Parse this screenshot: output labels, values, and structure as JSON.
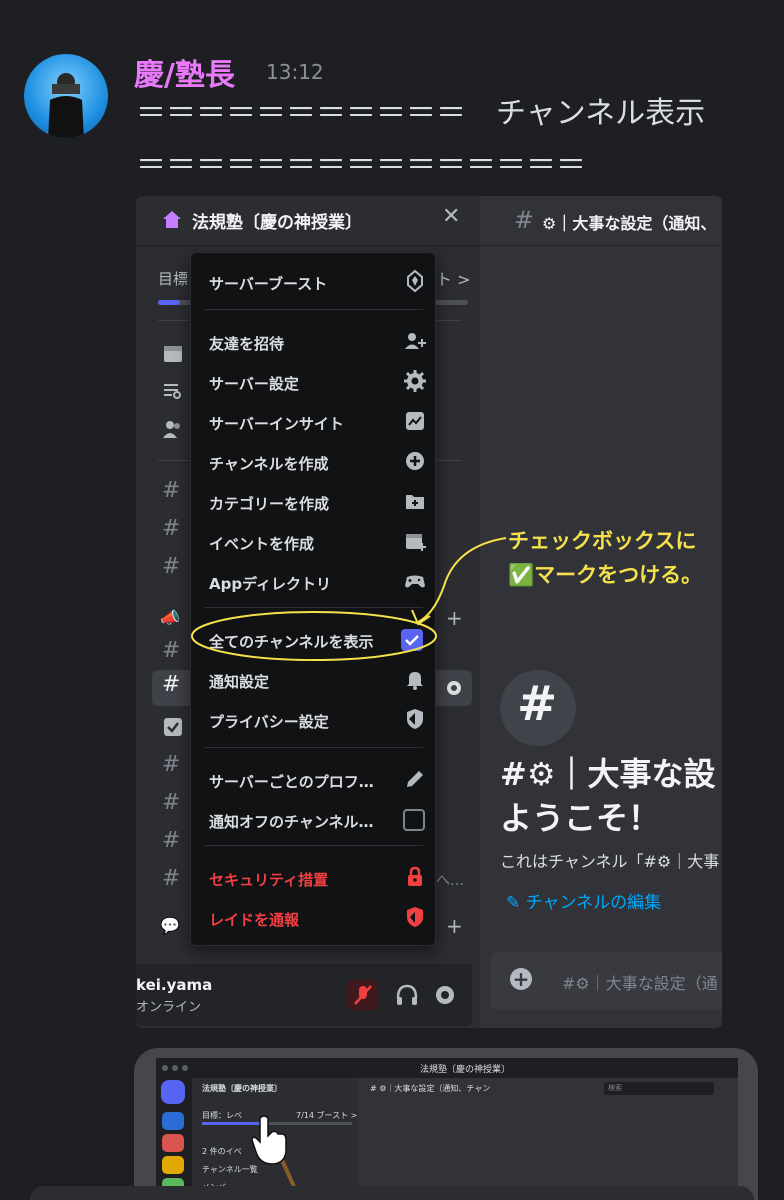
{
  "message": {
    "author": "慶/塾長",
    "timestamp": "13:12",
    "line1": "＝＝＝＝＝＝＝＝＝＝＝　チャンネル表示",
    "line2": "＝＝＝＝＝＝＝＝＝＝＝＝＝＝＝"
  },
  "screenshot": {
    "server_name": "法規塾〔慶の神授業〕",
    "channel_title": "⚙｜大事な設定（通知、",
    "goal_label": "目標",
    "goal_suffix": "ト >",
    "goal_progress": 0.07,
    "menu": {
      "items": [
        {
          "label": "サーバーブースト",
          "icon": "boost-icon"
        },
        {
          "label": "友達を招待",
          "icon": "invite-icon"
        },
        {
          "label": "サーバー設定",
          "icon": "gear-icon"
        },
        {
          "label": "サーバーインサイト",
          "icon": "insights-icon"
        },
        {
          "label": "チャンネルを作成",
          "icon": "plus-circle-icon"
        },
        {
          "label": "カテゴリーを作成",
          "icon": "folder-plus-icon"
        },
        {
          "label": "イベントを作成",
          "icon": "calendar-plus-icon"
        },
        {
          "label": "Appディレクトリ",
          "icon": "gamepad-icon"
        },
        {
          "label": "全てのチャンネルを表示",
          "icon": "checkbox-checked"
        },
        {
          "label": "通知設定",
          "icon": "bell-icon"
        },
        {
          "label": "プライバシー設定",
          "icon": "shield-icon"
        },
        {
          "label": "サーバーごとのプロフ…",
          "icon": "pencil-icon"
        },
        {
          "label": "通知オフのチャンネル…",
          "icon": "checkbox-empty"
        },
        {
          "label": "セキュリティ措置",
          "icon": "lock-icon"
        },
        {
          "label": "レイドを通報",
          "icon": "shield-report-icon"
        }
      ]
    },
    "annotation": [
      "チェックボックスに",
      "✅マークをつける。"
    ],
    "user": {
      "name": "kei.yama",
      "status": "オンライン"
    },
    "welcome_title_1": "#⚙｜大事な設",
    "welcome_title_2": "ようこそ！",
    "welcome_desc": "これはチャンネル「#⚙｜大事",
    "edit_link": "✎ チャンネルの編集",
    "message_placeholder": "#⚙｜大事な設定（通",
    "truncated_channel": "へ…",
    "colors": {
      "accent": "#5865f2",
      "danger": "#f23f42",
      "annotation": "#f5e14b",
      "author": "#e879f9"
    }
  },
  "laptop": {
    "window_title": "法規塾〔慶の神授業〕",
    "server_name": "法規塾〔慶の神授業〕",
    "goal": "目標：レベ",
    "boost": "7/14 ブースト >",
    "events": "2 件のイベ",
    "channel_list": "チャンネル一覧",
    "members": "メンバ",
    "channel_title": "# ⚙｜大事な設定（通知、チャン",
    "search": "検索"
  }
}
